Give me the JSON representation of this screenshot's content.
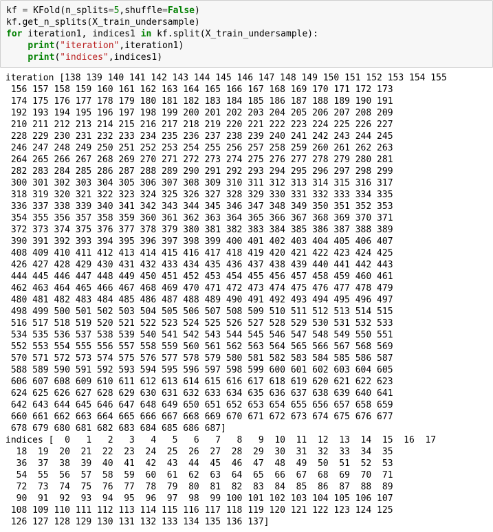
{
  "code": {
    "line1": {
      "a": "kf ",
      "op": "=",
      "sp": " ",
      "fn": "KFold",
      "lp": "(",
      "arg1": "n_splits",
      "eq1": "=",
      "num1": "5",
      "comma": ",",
      "arg2": "shuffle",
      "eq2": "=",
      "bool": "False",
      "rp": ")"
    },
    "line2": "kf.get_n_splits(X_train_undersample)",
    "line3": {
      "for": "for",
      "mid": " iteration1, indices1 ",
      "in": "in",
      "tail": " kf.split(X_train_undersample):"
    },
    "line4": {
      "indent": "    ",
      "print": "print",
      "lp": "(",
      "str": "\"iteration\"",
      "comma": ",",
      "arg": "iteration1",
      "rp": ")"
    },
    "line5": {
      "indent": "    ",
      "print": "print",
      "lp": "(",
      "str": "\"indices\"",
      "comma": ",",
      "arg": "indices1",
      "rp": ")"
    }
  },
  "out_iteration": "iteration [138 139 140 141 142 143 144 145 146 147 148 149 150 151 152 153 154 155\n 156 157 158 159 160 161 162 163 164 165 166 167 168 169 170 171 172 173\n 174 175 176 177 178 179 180 181 182 183 184 185 186 187 188 189 190 191\n 192 193 194 195 196 197 198 199 200 201 202 203 204 205 206 207 208 209\n 210 211 212 213 214 215 216 217 218 219 220 221 222 223 224 225 226 227\n 228 229 230 231 232 233 234 235 236 237 238 239 240 241 242 243 244 245\n 246 247 248 249 250 251 252 253 254 255 256 257 258 259 260 261 262 263\n 264 265 266 267 268 269 270 271 272 273 274 275 276 277 278 279 280 281\n 282 283 284 285 286 287 288 289 290 291 292 293 294 295 296 297 298 299\n 300 301 302 303 304 305 306 307 308 309 310 311 312 313 314 315 316 317\n 318 319 320 321 322 323 324 325 326 327 328 329 330 331 332 333 334 335\n 336 337 338 339 340 341 342 343 344 345 346 347 348 349 350 351 352 353\n 354 355 356 357 358 359 360 361 362 363 364 365 366 367 368 369 370 371\n 372 373 374 375 376 377 378 379 380 381 382 383 384 385 386 387 388 389\n 390 391 392 393 394 395 396 397 398 399 400 401 402 403 404 405 406 407\n 408 409 410 411 412 413 414 415 416 417 418 419 420 421 422 423 424 425\n 426 427 428 429 430 431 432 433 434 435 436 437 438 439 440 441 442 443\n 444 445 446 447 448 449 450 451 452 453 454 455 456 457 458 459 460 461\n 462 463 464 465 466 467 468 469 470 471 472 473 474 475 476 477 478 479\n 480 481 482 483 484 485 486 487 488 489 490 491 492 493 494 495 496 497\n 498 499 500 501 502 503 504 505 506 507 508 509 510 511 512 513 514 515\n 516 517 518 519 520 521 522 523 524 525 526 527 528 529 530 531 532 533\n 534 535 536 537 538 539 540 541 542 543 544 545 546 547 548 549 550 551\n 552 553 554 555 556 557 558 559 560 561 562 563 564 565 566 567 568 569\n 570 571 572 573 574 575 576 577 578 579 580 581 582 583 584 585 586 587\n 588 589 590 591 592 593 594 595 596 597 598 599 600 601 602 603 604 605\n 606 607 608 609 610 611 612 613 614 615 616 617 618 619 620 621 622 623\n 624 625 626 627 628 629 630 631 632 633 634 635 636 637 638 639 640 641\n 642 643 644 645 646 647 648 649 650 651 652 653 654 655 656 657 658 659\n 660 661 662 663 664 665 666 667 668 669 670 671 672 673 674 675 676 677\n 678 679 680 681 682 683 684 685 686 687]",
  "out_indices": "indices [  0   1   2   3   4   5   6   7   8   9  10  11  12  13  14  15  16  17\n  18  19  20  21  22  23  24  25  26  27  28  29  30  31  32  33  34  35\n  36  37  38  39  40  41  42  43  44  45  46  47  48  49  50  51  52  53\n  54  55  56  57  58  59  60  61  62  63  64  65  66  67  68  69  70  71\n  72  73  74  75  76  77  78  79  80  81  82  83  84  85  86  87  88  89\n  90  91  92  93  94  95  96  97  98  99 100 101 102 103 104 105 106 107\n 108 109 110 111 112 113 114 115 116 117 118 119 120 121 122 123 124 125\n 126 127 128 129 130 131 132 133 134 135 136 137]"
}
